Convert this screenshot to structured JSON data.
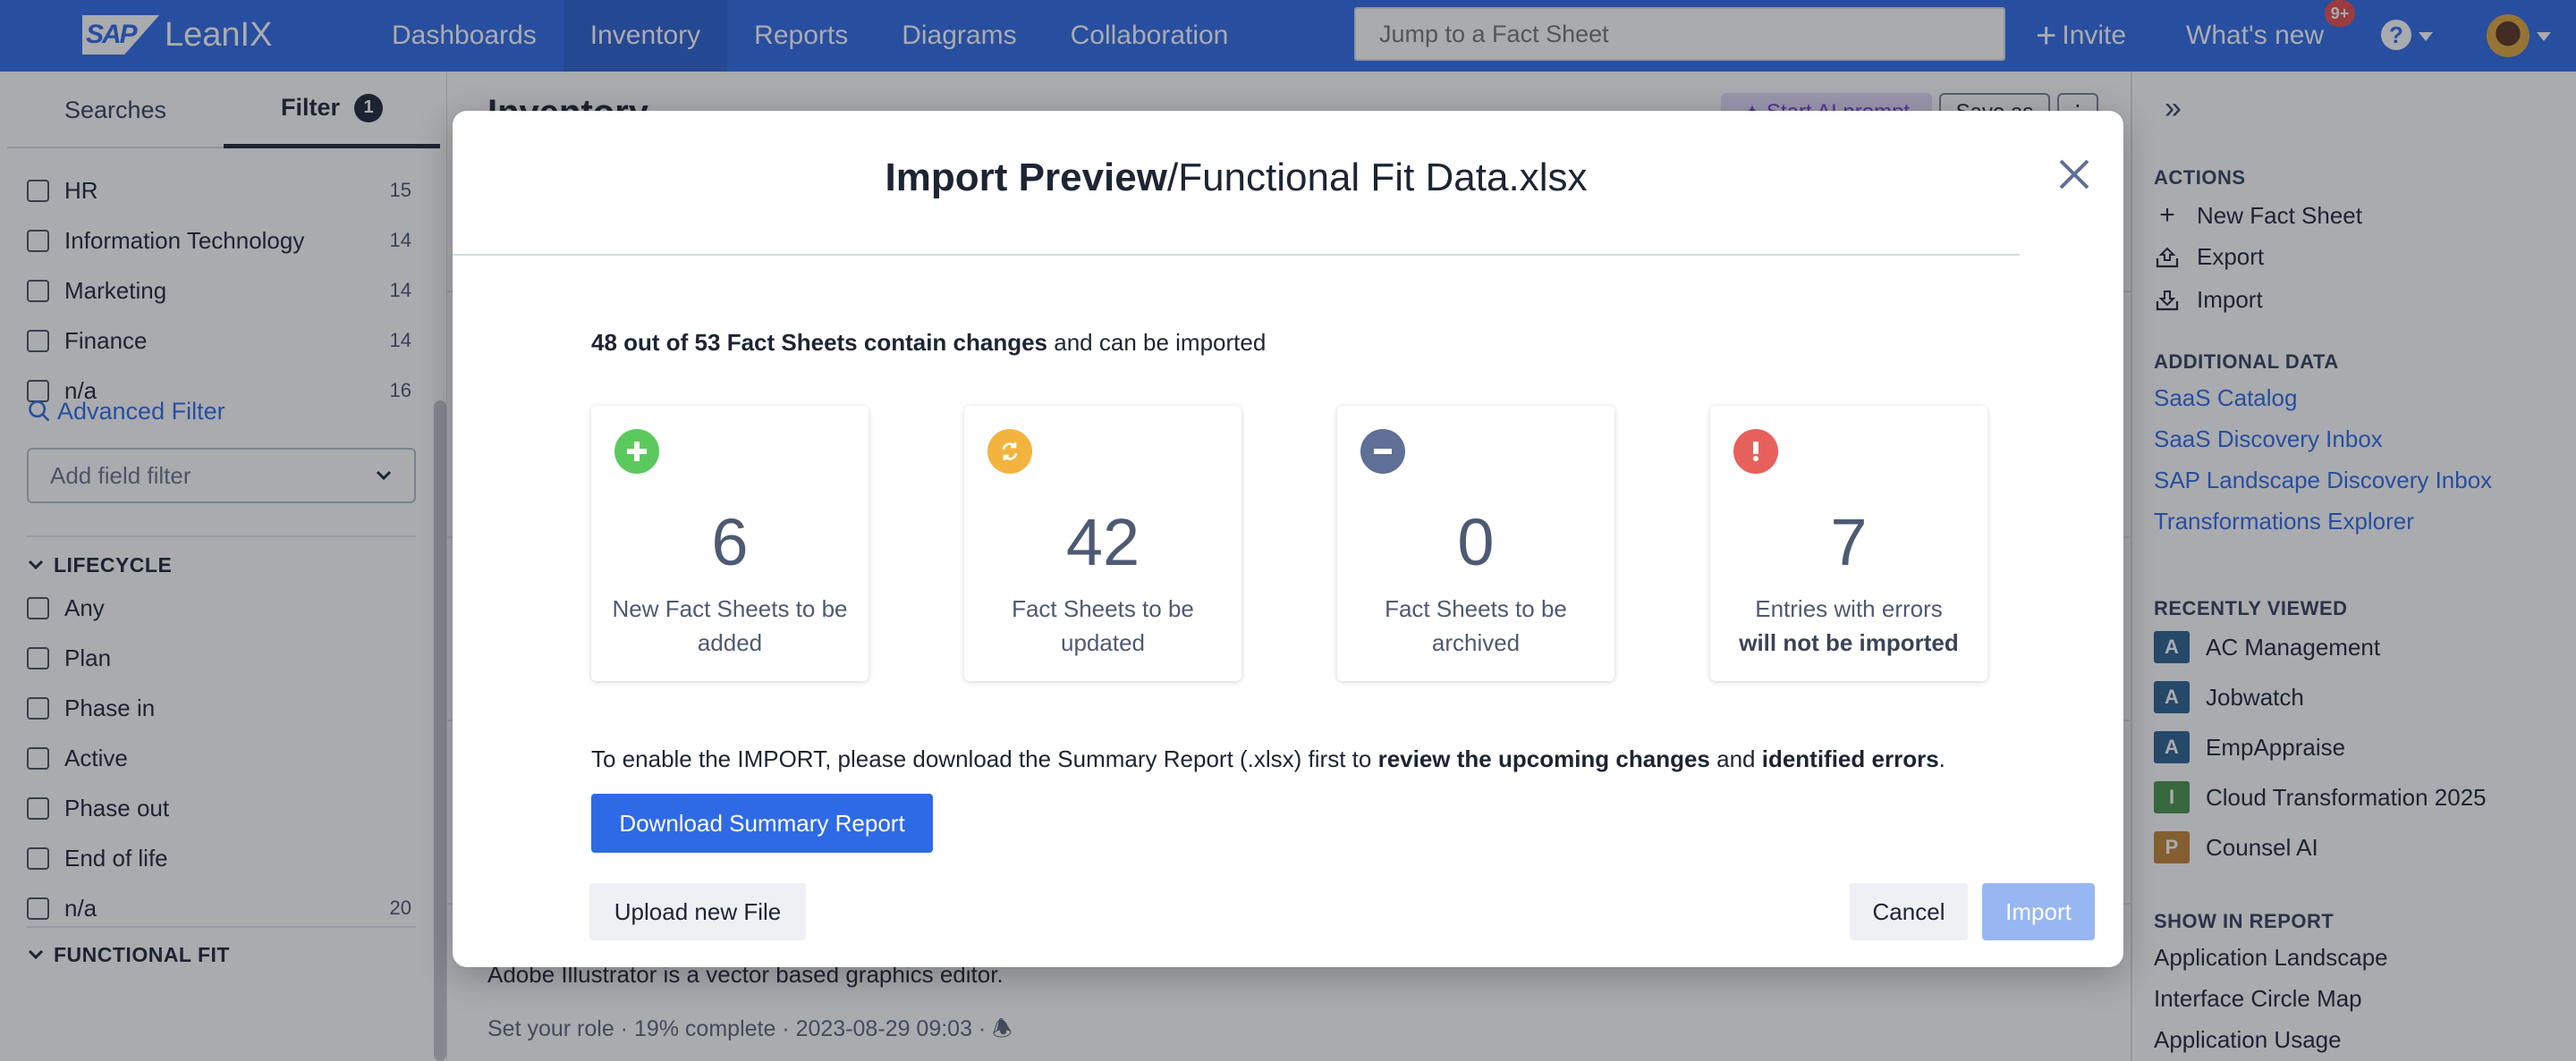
{
  "topbar": {
    "logo_sap": "SAP",
    "logo_text": "LeanIX",
    "nav": [
      {
        "label": "Dashboards",
        "active": false
      },
      {
        "label": "Inventory",
        "active": true
      },
      {
        "label": "Reports",
        "active": false
      },
      {
        "label": "Diagrams",
        "active": false
      },
      {
        "label": "Collaboration",
        "active": false
      }
    ],
    "search_placeholder": "Jump to a Fact Sheet",
    "invite_label": "Invite",
    "whats_new_label": "What's new",
    "whats_new_badge": "9+",
    "help_glyph": "?"
  },
  "left_sidebar": {
    "tabs": [
      {
        "label": "Searches",
        "active": false
      },
      {
        "label": "Filter",
        "active": true,
        "badge": "1"
      }
    ],
    "org_filters": [
      {
        "label": "HR",
        "count": "15"
      },
      {
        "label": "Information Technology",
        "count": "14"
      },
      {
        "label": "Marketing",
        "count": "14"
      },
      {
        "label": "Finance",
        "count": "14"
      },
      {
        "label": "n/a",
        "count": "16"
      }
    ],
    "advanced_filter_label": "Advanced Filter",
    "add_field_filter_placeholder": "Add field filter",
    "lifecycle": {
      "title": "LIFECYCLE",
      "items": [
        {
          "label": "Any",
          "count": ""
        },
        {
          "label": "Plan",
          "count": ""
        },
        {
          "label": "Phase in",
          "count": ""
        },
        {
          "label": "Active",
          "count": ""
        },
        {
          "label": "Phase out",
          "count": ""
        },
        {
          "label": "End of life",
          "count": ""
        },
        {
          "label": "n/a",
          "count": "20"
        }
      ]
    },
    "functional_fit_title": "FUNCTIONAL FIT"
  },
  "main": {
    "title": "Inventory",
    "ai_prompt_label": "Start AI prompt",
    "save_as_label": "Save as",
    "more_label": "⋮",
    "visible_row": {
      "description": "Adobe Illustrator is a vector based graphics editor.",
      "meta": "Set your role · 19% complete · 2023-08-29 09:03 ·"
    }
  },
  "right_sidebar": {
    "actions_title": "ACTIONS",
    "actions": [
      {
        "icon": "plus-icon",
        "label": "New Fact Sheet"
      },
      {
        "icon": "export-icon",
        "label": "Export"
      },
      {
        "icon": "import-icon",
        "label": "Import"
      }
    ],
    "additional_title": "ADDITIONAL DATA",
    "additional_links": [
      "SaaS Catalog",
      "SaaS Discovery Inbox",
      "SAP Landscape Discovery Inbox",
      "Transformations Explorer"
    ],
    "recent_title": "RECENTLY VIEWED",
    "recent": [
      {
        "badge": "A",
        "color": "#2d5f8f",
        "label": "AC Management"
      },
      {
        "badge": "A",
        "color": "#2d5f8f",
        "label": "Jobwatch"
      },
      {
        "badge": "A",
        "color": "#2d5f8f",
        "label": "EmpAppraise"
      },
      {
        "badge": "I",
        "color": "#48944a",
        "label": "Cloud Transformation 2025"
      },
      {
        "badge": "P",
        "color": "#c58432",
        "label": "Counsel AI"
      }
    ],
    "report_title": "SHOW IN REPORT",
    "reports": [
      "Application Landscape",
      "Interface Circle Map",
      "Application Usage"
    ]
  },
  "modal": {
    "title_bold": "Import Preview",
    "title_rest": "/Functional Fit Data.xlsx",
    "summary_bold": "48 out of 53 Fact Sheets contain changes",
    "summary_rest": " and can be imported",
    "cards": [
      {
        "icon": "plus-circle-icon",
        "color": "#5cc95e",
        "value": "6",
        "label": "New Fact Sheets to be added",
        "label_bold": ""
      },
      {
        "icon": "refresh-circle-icon",
        "color": "#f3b43f",
        "value": "42",
        "label": "Fact Sheets to be updated",
        "label_bold": ""
      },
      {
        "icon": "minus-circle-icon",
        "color": "#5f6f96",
        "value": "0",
        "label": "Fact Sheets to be archived",
        "label_bold": ""
      },
      {
        "icon": "exclamation-circle-icon",
        "color": "#e8605c",
        "value": "7",
        "label": "Entries with errors",
        "label_bold": "will not be imported"
      }
    ],
    "enable_text_1": "To enable the IMPORT, please download the Summary Report (.xlsx) first to ",
    "enable_bold_1": "review the upcoming changes",
    "enable_text_2": " and ",
    "enable_bold_2": "identified errors",
    "enable_text_3": ".",
    "download_label": "Download Summary Report",
    "upload_label": "Upload new File",
    "cancel_label": "Cancel",
    "import_label": "Import"
  }
}
